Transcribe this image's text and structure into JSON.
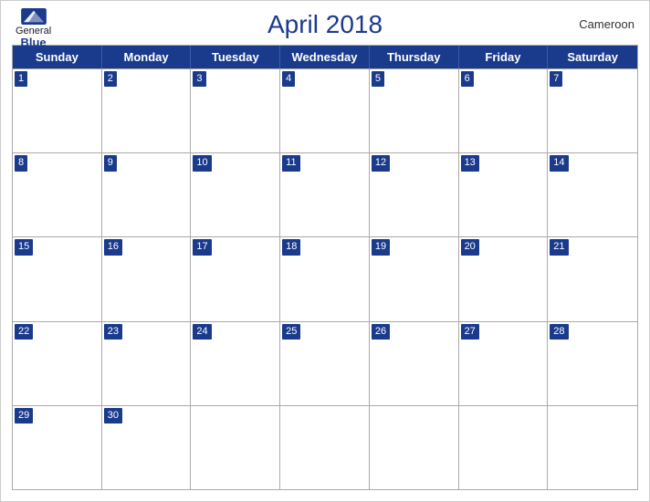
{
  "header": {
    "title": "April 2018",
    "logo": {
      "general": "General",
      "blue": "Blue"
    },
    "country": "Cameroon"
  },
  "calendar": {
    "days_of_week": [
      "Sunday",
      "Monday",
      "Tuesday",
      "Wednesday",
      "Thursday",
      "Friday",
      "Saturday"
    ],
    "weeks": [
      [
        {
          "day": 1,
          "empty": false
        },
        {
          "day": 2,
          "empty": false
        },
        {
          "day": 3,
          "empty": false
        },
        {
          "day": 4,
          "empty": false
        },
        {
          "day": 5,
          "empty": false
        },
        {
          "day": 6,
          "empty": false
        },
        {
          "day": 7,
          "empty": false
        }
      ],
      [
        {
          "day": 8,
          "empty": false
        },
        {
          "day": 9,
          "empty": false
        },
        {
          "day": 10,
          "empty": false
        },
        {
          "day": 11,
          "empty": false
        },
        {
          "day": 12,
          "empty": false
        },
        {
          "day": 13,
          "empty": false
        },
        {
          "day": 14,
          "empty": false
        }
      ],
      [
        {
          "day": 15,
          "empty": false
        },
        {
          "day": 16,
          "empty": false
        },
        {
          "day": 17,
          "empty": false
        },
        {
          "day": 18,
          "empty": false
        },
        {
          "day": 19,
          "empty": false
        },
        {
          "day": 20,
          "empty": false
        },
        {
          "day": 21,
          "empty": false
        }
      ],
      [
        {
          "day": 22,
          "empty": false
        },
        {
          "day": 23,
          "empty": false
        },
        {
          "day": 24,
          "empty": false
        },
        {
          "day": 25,
          "empty": false
        },
        {
          "day": 26,
          "empty": false
        },
        {
          "day": 27,
          "empty": false
        },
        {
          "day": 28,
          "empty": false
        }
      ],
      [
        {
          "day": 29,
          "empty": false
        },
        {
          "day": 30,
          "empty": false
        },
        {
          "day": null,
          "empty": true
        },
        {
          "day": null,
          "empty": true
        },
        {
          "day": null,
          "empty": true
        },
        {
          "day": null,
          "empty": true
        },
        {
          "day": null,
          "empty": true
        }
      ]
    ]
  }
}
